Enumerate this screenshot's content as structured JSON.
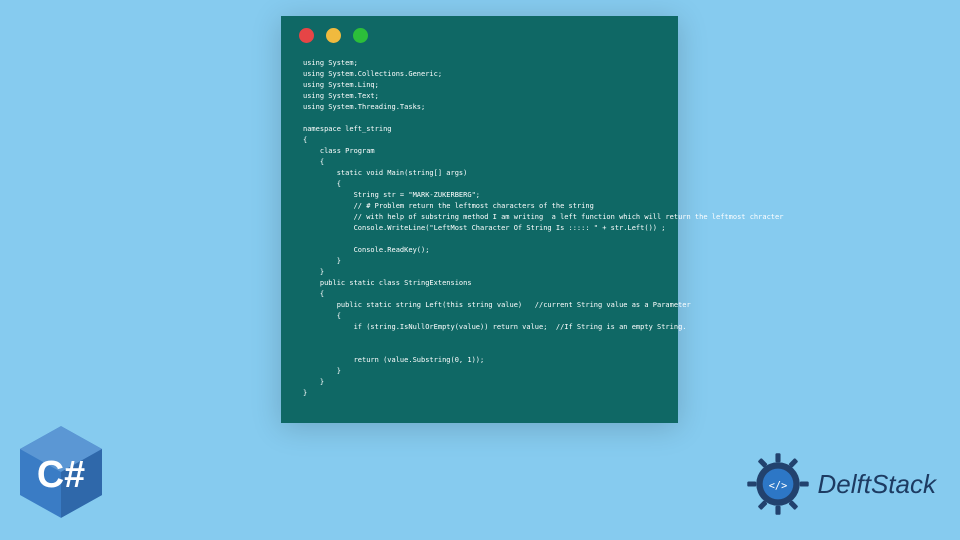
{
  "editor": {
    "window_icons": {
      "red": "close-icon",
      "yellow": "minimize-icon",
      "green": "zoom-icon"
    },
    "code_lines": [
      "using System;",
      "using System.Collections.Generic;",
      "using System.Linq;",
      "using System.Text;",
      "using System.Threading.Tasks;",
      "",
      "namespace left_string",
      "{",
      "    class Program",
      "    {",
      "        static void Main(string[] args)",
      "        {",
      "            String str = \"MARK-ZUKERBERG\";",
      "            // # Problem return the leftmost characters of the string",
      "            // with help of substring method I am writing  a left function which will return the leftmost chracter",
      "            Console.WriteLine(\"LeftMost Character Of String Is ::::: \" + str.Left()) ;",
      "",
      "            Console.ReadKey();",
      "        }",
      "    }",
      "    public static class StringExtensions",
      "    {",
      "        public static string Left(this string value)   //current String value as a Parameter",
      "        {",
      "            if (string.IsNullOrEmpty(value)) return value;  //If String is an empty String.",
      "",
      "",
      "            return (value.Substring(0, 1));",
      "        }",
      "    }",
      "}"
    ]
  },
  "csharp_badge": {
    "label": "C#"
  },
  "brand": {
    "name": "DelftStack"
  }
}
